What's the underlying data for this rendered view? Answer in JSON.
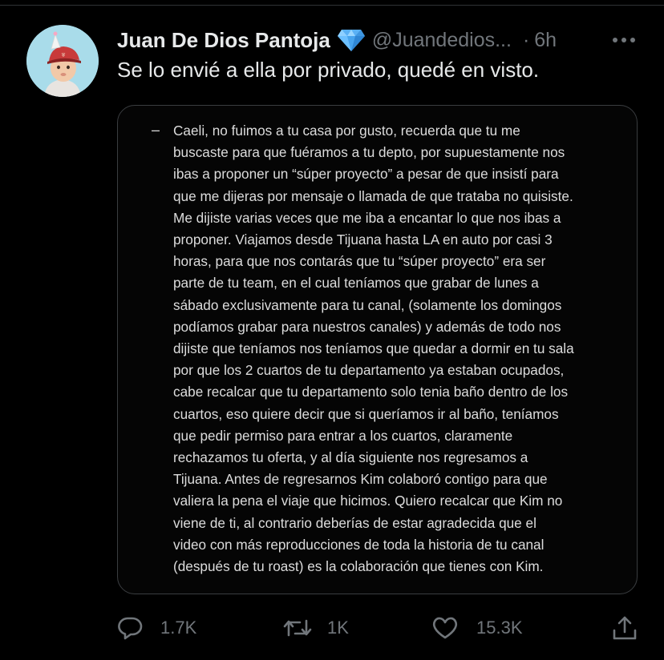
{
  "tweet": {
    "author_name": "Juan De Dios Pantoja",
    "handle": "@Juandedios...",
    "separator": "·",
    "time": "6h",
    "text": "Se lo envié a ella por privado, quedé en visto.",
    "avatar_icon": "baby-avatar",
    "verified_icon": "diamond-icon",
    "more_icon": "more-dots-icon"
  },
  "media": {
    "dash": "–",
    "lines": [
      "Caeli, no fuimos a tu casa por gusto, recuerda que tu me",
      "buscaste para que fuéramos a tu depto, por supuestamente nos",
      "ibas a proponer un “súper proyecto” a pesar de que insistí para",
      "que me dijeras por mensaje o llamada de que trataba no quisiste.",
      "Me dijiste varias veces que me iba a encantar lo que nos ibas a",
      "proponer. Viajamos desde Tijuana hasta LA en auto por casi 3",
      "horas, para que nos contarás que tu “súper proyecto” era ser",
      "parte de tu team, en el cual teníamos que grabar de lunes a",
      "sábado exclusivamente para tu canal, (solamente los domingos",
      "podíamos grabar para nuestros canales) y además de todo nos",
      "dijiste que teníamos nos teníamos que quedar a dormir en tu sala",
      "por que los 2 cuartos de tu departamento ya estaban ocupados,",
      "cabe recalcar que tu departamento solo tenia baño dentro de los",
      "cuartos, eso quiere decir que si queríamos ir al baño,  teníamos",
      "que pedir permiso para entrar a los cuartos, claramente",
      "rechazamos tu oferta, y al día siguiente nos regresamos a",
      "Tijuana. Antes de regresarnos Kim colaboró contigo para que",
      "valiera la pena el viaje que hicimos. Quiero recalcar que Kim no",
      "viene de ti, al contrario deberías de estar agradecida que el",
      "video con más reproducciones de toda la historia de tu canal",
      "(después  de tu roast) es la colaboración que tienes con Kim."
    ]
  },
  "actions": {
    "reply_count": "1.7K",
    "retweet_count": "1K",
    "like_count": "15.3K",
    "reply_icon": "reply-icon",
    "retweet_icon": "retweet-icon",
    "like_icon": "heart-icon",
    "share_icon": "share-icon"
  },
  "colors": {
    "background": "#000000",
    "text": "#e7e9ea",
    "muted": "#71767b",
    "avatar_bg": "#a9dcea",
    "verified": "#5ab1f5"
  }
}
